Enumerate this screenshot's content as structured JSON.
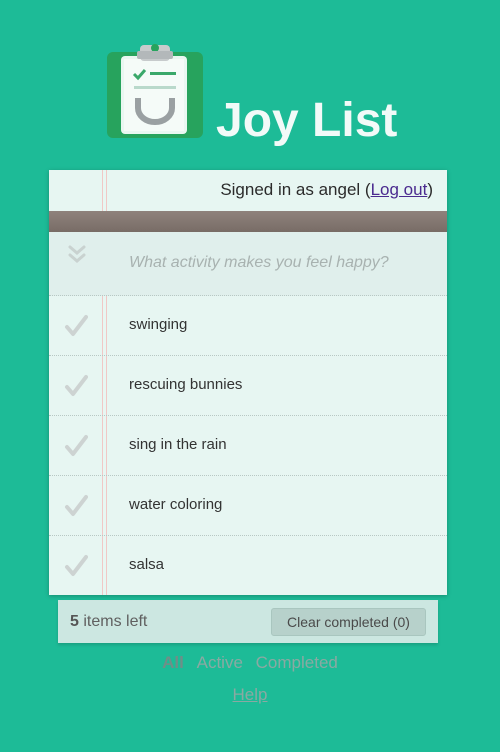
{
  "app": {
    "title": "Joy List",
    "logo_icon": "clipboard-smile-icon",
    "colors": {
      "background": "#1dbb97",
      "logo_green": "#27a35d",
      "card": "#e7f6f2",
      "header_bar": "#857872",
      "link": "#4a2a8f"
    }
  },
  "account": {
    "prefix": "Signed in as angel (",
    "logout_label": "Log out",
    "suffix": ")"
  },
  "new_todo": {
    "placeholder": "What activity makes you feel happy?",
    "value": "",
    "toggle_icon": "double-chevron-down-icon"
  },
  "todos": [
    {
      "label": "swinging",
      "icon": "checkmark-icon"
    },
    {
      "label": "rescuing bunnies",
      "icon": "checkmark-icon"
    },
    {
      "label": "sing in the rain",
      "icon": "checkmark-icon"
    },
    {
      "label": "water coloring",
      "icon": "checkmark-icon"
    },
    {
      "label": "salsa",
      "icon": "checkmark-icon"
    }
  ],
  "footer": {
    "count": "5",
    "count_suffix": " items left",
    "clear_label": "Clear completed (0)"
  },
  "filters": {
    "all": "All",
    "active": "Active",
    "completed": "Completed",
    "selected": "All"
  },
  "help_label": "Help"
}
